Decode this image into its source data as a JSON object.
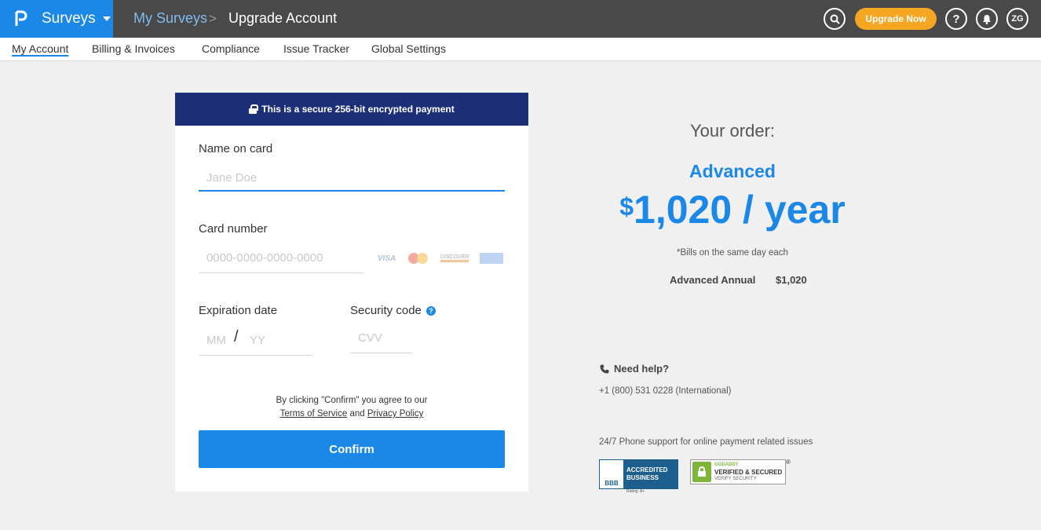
{
  "header": {
    "brand": "Surveys",
    "breadcrumb_parent": "My Surveys",
    "breadcrumb_separator": ">",
    "breadcrumb_current": "Upgrade Account",
    "upgrade_label": "Upgrade Now",
    "help_label": "?",
    "avatar_initials": "ZG"
  },
  "subnav": {
    "items": [
      "My Account",
      "Billing & Invoices",
      "Compliance",
      "Issue Tracker",
      "Global Settings"
    ],
    "active": "My Account"
  },
  "payment": {
    "secure_banner": "This is a secure 256-bit encrypted payment",
    "name_label": "Name on card",
    "name_placeholder": "Jane Doe",
    "card_label": "Card number",
    "card_placeholder": "0000-0000-0000-0000",
    "card_brands": [
      "VISA",
      "MasterCard",
      "DISCOVER",
      "AMERICAN EXPRESS"
    ],
    "expiry_label": "Expiration date",
    "mm_placeholder": "MM",
    "expiry_separator": "/",
    "yy_placeholder": "YY",
    "cvv_label": "Security code",
    "cvv_help": "?",
    "cvv_placeholder": "CVV",
    "agree_text": "By clicking \"Confirm\" you agree to our",
    "terms_link": "Terms of Service",
    "and_text": "and",
    "privacy_link": "Privacy Policy",
    "confirm_label": "Confirm"
  },
  "order": {
    "title": "Your order:",
    "plan": "Advanced",
    "currency": "$",
    "price": "1,020 / year",
    "bills_note": "*Bills on the same day each",
    "line_item_name": "Advanced Annual",
    "line_item_amount": "$1,020"
  },
  "support": {
    "need_help": "Need help?",
    "phone": "+1 (800) 531 0228 (International)",
    "note": "24/7 Phone support for online payment related issues"
  },
  "badges": {
    "bbb_logo": "BBB",
    "bbb_line1": "ACCREDITED",
    "bbb_line2": "BUSINESS",
    "bbb_rating": "Rating: A+",
    "gd_line1": "GODADDY",
    "gd_line2": "VERIFIED & SECURED",
    "gd_line3": "VERIFY SECURITY",
    "gd_reg": "®"
  },
  "colors": {
    "brand_blue": "#1b87e6",
    "topbar": "#494949",
    "secure_banner": "#1e2f7a",
    "upgrade": "#f5a623"
  }
}
